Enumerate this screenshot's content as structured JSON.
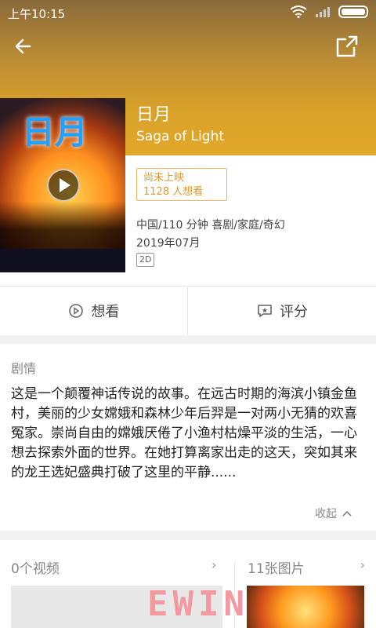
{
  "status_bar": {
    "time": "上午10:15"
  },
  "movie": {
    "title": "日月",
    "subtitle": "Saga of Light",
    "poster_title": "日月",
    "status": "尚未上映",
    "want_count": "1128 人想看",
    "meta_line1": "中国/110 分钟  喜剧/家庭/奇幻",
    "release": "2019年07月",
    "format": "2D"
  },
  "actions": {
    "want": "想看",
    "rate": "评分"
  },
  "plot": {
    "heading": "剧情",
    "text": "这是一个颠覆神话传说的故事。在远古时期的海滨小镇金鱼村，美丽的少女嫦娥和森林少年后羿是一对两小无猜的欢喜冤家。崇尚自由的嫦娥厌倦了小渔村枯燥平淡的生活，一心想去探索外面的世界。在她打算离家出走的这天，突如其来的龙王选妃盛典打破了这里的平静......",
    "collapse": "收起"
  },
  "media": {
    "videos": "0个视频",
    "photos": "11张图片"
  },
  "watermark": "EWIN",
  "colors": {
    "header_gold": "#e3a82a",
    "badge_orange": "#e39a2d"
  }
}
